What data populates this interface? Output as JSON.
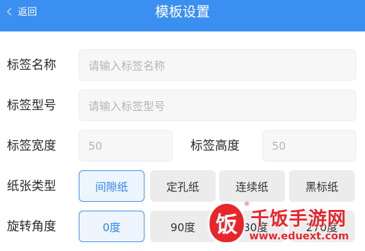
{
  "header": {
    "back_label": "返回",
    "title": "模板设置"
  },
  "form": {
    "name": {
      "label": "标签名称",
      "placeholder": "请输入标签名称"
    },
    "model": {
      "label": "标签型号",
      "placeholder": "请输入标签型号"
    },
    "width": {
      "label": "标签宽度",
      "value": "50"
    },
    "height": {
      "label": "标签高度",
      "value": "50"
    },
    "paper_type": {
      "label": "纸张类型",
      "options": [
        "间隙纸",
        "定孔纸",
        "连续纸",
        "黑标纸"
      ],
      "selected": "间隙纸"
    },
    "rotation": {
      "label": "旋转角度",
      "options": [
        "0度",
        "90度",
        "180度",
        "270度"
      ],
      "selected": "0度"
    }
  },
  "watermark": {
    "logo_char": "饭",
    "name": "千饭手游网",
    "url": "www.eduext.com",
    "reg": "®"
  },
  "colors": {
    "accent": "#3b8ff0",
    "watermark": "#e8252b"
  }
}
